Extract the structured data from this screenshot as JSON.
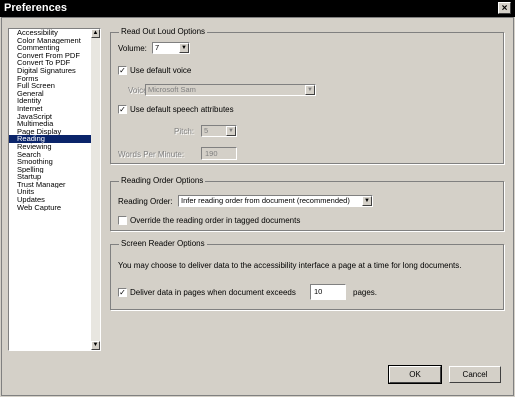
{
  "window": {
    "title": "Preferences",
    "close_glyph": "×"
  },
  "sidebar": {
    "items": [
      "Accessibility",
      "Color Management",
      "Commenting",
      "Convert From PDF",
      "Convert To PDF",
      "Digital Signatures",
      "Forms",
      "Full Screen",
      "General",
      "Identity",
      "Internet",
      "JavaScript",
      "Multimedia",
      "Page Display",
      "Reading",
      "Reviewing",
      "Search",
      "Smoothing",
      "Spelling",
      "Startup",
      "Trust Manager",
      "Units",
      "Updates",
      "Web Capture"
    ],
    "selected_index": 14,
    "scroll_up_glyph": "▲",
    "scroll_down_glyph": "▼"
  },
  "read_out_loud": {
    "legend": "Read Out Loud Options",
    "volume_label": "Volume:",
    "volume_value": "7",
    "use_default_voice_label": "Use default voice",
    "use_default_voice_checked": true,
    "voice_label": "Voice:",
    "voice_value": "Microsoft Sam",
    "use_default_speech_label": "Use default speech attributes",
    "use_default_speech_checked": true,
    "pitch_label": "Pitch:",
    "pitch_value": "5",
    "words_per_minute_label": "Words Per Minute:",
    "words_per_minute_value": "190"
  },
  "reading_order": {
    "legend": "Reading Order Options",
    "order_label": "Reading Order:",
    "order_value": "Infer reading order from document (recommended)",
    "override_label": "Override the reading order in tagged documents",
    "override_checked": false
  },
  "screen_reader": {
    "legend": "Screen Reader Options",
    "description": "You may choose to deliver data to the accessibility interface a page at a time for long documents.",
    "deliver_label": "Deliver data in pages when document exceeds",
    "deliver_checked": true,
    "pages_value": "10",
    "pages_suffix": "pages."
  },
  "buttons": {
    "ok": "OK",
    "cancel": "Cancel"
  },
  "glyphs": {
    "check": "✓",
    "dropdown": "▼"
  }
}
